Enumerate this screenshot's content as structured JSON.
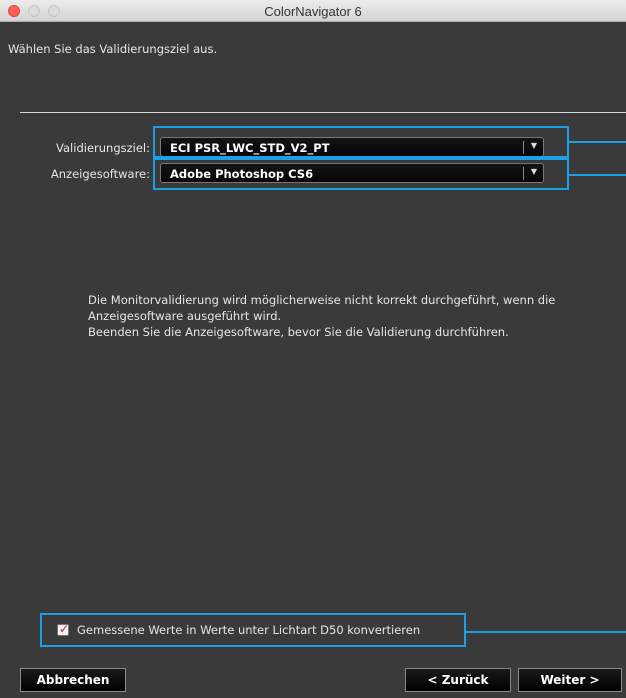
{
  "window": {
    "title": "ColorNavigator 6"
  },
  "instruction": "Wählen Sie das Validierungsziel aus.",
  "validation_target": {
    "label": "Validierungsziel:",
    "value": "ECI PSR_LWC_STD_V2_PT"
  },
  "display_software": {
    "label": "Anzeigesoftware:",
    "value": "Adobe Photoshop CS6"
  },
  "message": {
    "line1": "Die Monitorvalidierung wird möglicherweise nicht korrekt durchgeführt, wenn die",
    "line2": "Anzeigesoftware ausgeführt wird.",
    "line3": "Beenden Sie die Anzeigesoftware, bevor Sie die Validierung durchführen."
  },
  "convert_checkbox": {
    "label": "Gemessene Werte in Werte unter Lichtart D50 konvertieren",
    "checked": true
  },
  "buttons": {
    "cancel": "Abbrechen",
    "back": "< Zurück",
    "next": "Weiter >"
  },
  "colors": {
    "highlight": "#1aa0e6",
    "background": "#3a3a3a",
    "check_mark": "#d22020"
  }
}
